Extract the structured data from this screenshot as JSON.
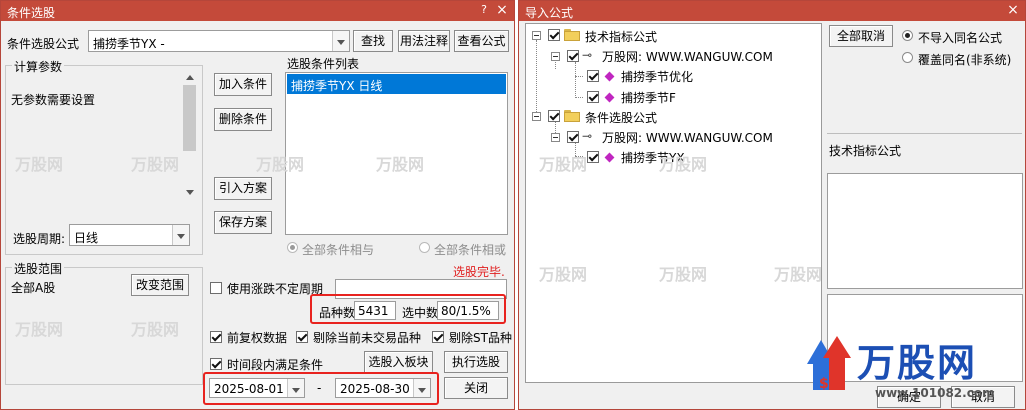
{
  "left_window": {
    "title": "条件选股",
    "formula_label": "条件选股公式",
    "formula_value": "捕捞季节YX  -",
    "find_button": "查找",
    "usage_button": "用法注释",
    "view_button": "查看公式",
    "calc_params_title": "计算参数",
    "no_params_text": "无参数需要设置",
    "period_label": "选股周期:",
    "period_value": "日线",
    "add_condition": "加入条件",
    "delete_condition": "删除条件",
    "import_scheme": "引入方案",
    "save_scheme": "保存方案",
    "condition_list_title": "选股条件列表",
    "condition_items": [
      "捕捞季节YX  日线"
    ],
    "radio_all_and": "全部条件相与",
    "radio_all_or": "全部条件相或",
    "status": "选股完毕.",
    "range_title": "选股范围",
    "range_value": "全部A股",
    "change_range": "改变范围",
    "use_variable_period": "使用涨跌不定周期",
    "count_label": "品种数",
    "count_value": "5431",
    "selected_label": "选中数",
    "selected_value": "80/1.5%",
    "pre_adjust": "前复权数据",
    "remove_untraded": "剔除当前未交易品种",
    "remove_st": "剔除ST品种",
    "period_satisfy": "时间段内满足条件",
    "to_board": "选股入板块",
    "run": "执行选股",
    "start_date": "2025-08-01",
    "date_sep": "-",
    "end_date": "2025-08-30",
    "close": "关闭",
    "close_icon": "close-x"
  },
  "right_window": {
    "title": "导入公式",
    "tree": {
      "group1": "技术指标公式",
      "source1": "万股网: WWW.WANGUW.COM",
      "item1": "捕捞季节优化",
      "item2": "捕捞季节F",
      "group2": "条件选股公式",
      "source2": "万股网: WWW.WANGUW.COM",
      "item3": "捕捞季节YX"
    },
    "cancel_all": "全部取消",
    "opt_no_import": "不导入同名公式",
    "opt_overwrite": "覆盖同名(非系统)",
    "info_title": "技术指标公式",
    "ok": "确定",
    "cancel": "取消",
    "close_icon": "close-x"
  },
  "watermarks": {
    "small": "万股网",
    "logo_text": "万股网",
    "url": "www.101082.com"
  },
  "colors": {
    "titlebar": "#c44a3a",
    "selection": "#0078d7",
    "highlight_red": "#e8231f",
    "logo_blue": "#1c4fb4"
  }
}
